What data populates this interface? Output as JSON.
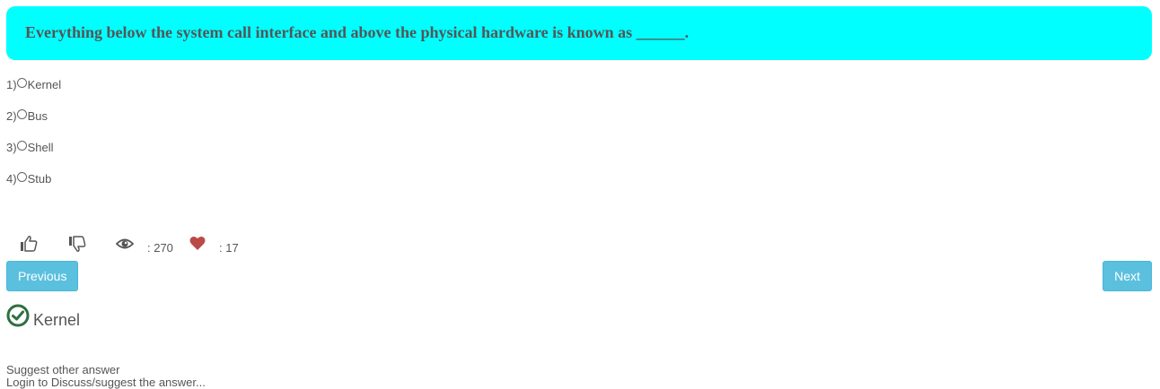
{
  "question": {
    "text": "Everything below the system call interface and above the physical hardware is known as ______."
  },
  "options": [
    {
      "number": "1)",
      "label": "Kernel"
    },
    {
      "number": "2)",
      "label": "Bus"
    },
    {
      "number": "3)",
      "label": "Shell"
    },
    {
      "number": "4)",
      "label": "Stub"
    }
  ],
  "stats": {
    "views": ": 270",
    "likes": ": 17"
  },
  "icons": {
    "thumbs_up": "thumbs-up-icon",
    "thumbs_down": "thumbs-down-icon",
    "views": "eye-icon",
    "favorites": "heart-icon",
    "correct": "check-circle-icon"
  },
  "navigation": {
    "previous_label": "Previous",
    "next_label": "Next"
  },
  "answer": {
    "label": "Kernel"
  },
  "footer": {
    "suggest_label": "Suggest other answer",
    "login_label": "Login to Discuss/suggest the answer..."
  },
  "colors": {
    "question_bg": "#00ffff",
    "button_bg": "#5bc0de",
    "heart": "#b94a48",
    "check": "#2e6f40"
  }
}
